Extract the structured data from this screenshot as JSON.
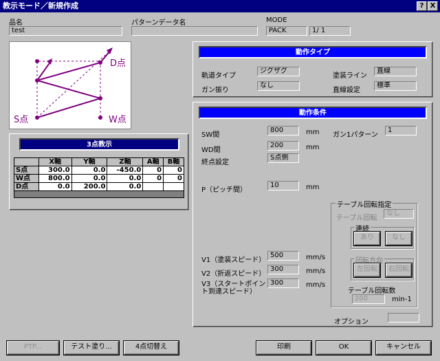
{
  "window": {
    "title": "教示モード／新規作成",
    "help_label": "?",
    "close_label": "X"
  },
  "header": {
    "product_name_label": "品名",
    "product_name_value": "test",
    "pattern_label": "パターンデータ名",
    "pattern_value": "",
    "mode_label": "MODE",
    "mode_value": "PACK",
    "page_value": "1/ 1"
  },
  "diagram": {
    "d_label": "D点",
    "s_label": "S点",
    "w_label": "W点",
    "line_color": "#7f0080",
    "bg_color": "#ffffff"
  },
  "teach": {
    "title": "3点教示",
    "columns": [
      "",
      "X軸",
      "Y軸",
      "Z軸",
      "A軸",
      "B軸"
    ],
    "rows": [
      {
        "name": "S点",
        "x": "300.0",
        "y": "0.0",
        "z": "-450.0",
        "a": "0",
        "b": "0"
      },
      {
        "name": "W点",
        "x": "800.0",
        "y": "0.0",
        "z": "0.0",
        "a": "0",
        "b": "0"
      },
      {
        "name": "D点",
        "x": "0.0",
        "y": "200.0",
        "z": "0.0",
        "a": "",
        "b": ""
      }
    ]
  },
  "motion_type": {
    "title": "動作タイプ",
    "track_label": "軌道タイプ",
    "track_value": "ジグザグ",
    "gun_swing_label": "ガン振り",
    "gun_swing_value": "なし",
    "coat_line_label": "塗装ライン",
    "coat_line_value": "直線",
    "linear_label": "直線設定",
    "linear_value": "標準"
  },
  "conditions": {
    "title": "動作条件",
    "sw_label": "SW間",
    "sw_value": "800",
    "sw_unit": "mm",
    "wd_label": "WD間",
    "wd_value": "200",
    "wd_unit": "mm",
    "end_label": "終点設定",
    "end_value": "S点側",
    "gun1_label": "ガン1パターン",
    "gun1_value": "1",
    "pitch_label": "P（ピッチ間）",
    "pitch_value": "10",
    "pitch_unit": "mm",
    "v1_label": "V1（塗装スピード）",
    "v1_value": "500",
    "v1_unit": "mm/s",
    "v2_label": "V2（折返スピード）",
    "v2_value": "300",
    "v2_unit": "mm/s",
    "v3_label_1": "V3（スタートポイン",
    "v3_label_2": "ト到達スピード）",
    "v3_value": "300",
    "v3_unit": "mm/s",
    "option_label": "オプション",
    "option_value": ""
  },
  "table_rotation": {
    "title": "テーブル回転指定",
    "rot_label": "テーブル回転",
    "rot_value": "なし",
    "continuous_title": "連続",
    "yes_label": "あり",
    "no_label": "なし",
    "direction_title": "回転方向",
    "left_label": "左回転",
    "right_label": "右回転",
    "count_label": "テーブル回転数",
    "count_value": "200",
    "count_unit": "min-1"
  },
  "footer": {
    "ptp_label": "PTP...",
    "test_coat_label": "テスト塗り...",
    "switch4_label": "4点切替え",
    "print_label": "印刷",
    "ok_label": "OK",
    "cancel_label": "キャンセル"
  }
}
